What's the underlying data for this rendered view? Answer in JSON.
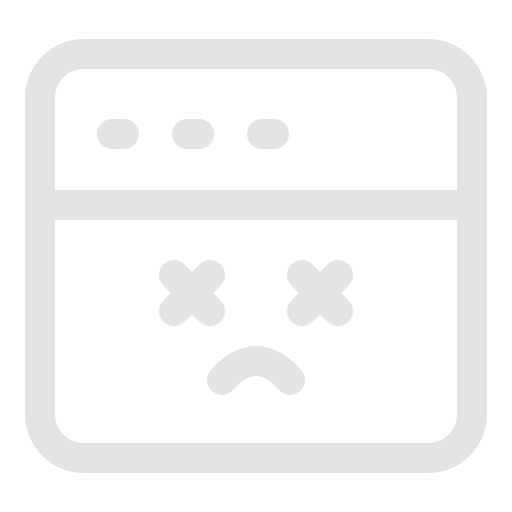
{
  "icon": {
    "name": "browser-error-icon",
    "color": "#e4e4e4",
    "parts": {
      "window": "browser-window-icon",
      "dots": "window-dots-icon",
      "left_eye": "x-eye-icon",
      "right_eye": "x-eye-icon",
      "mouth": "frown-icon"
    }
  }
}
